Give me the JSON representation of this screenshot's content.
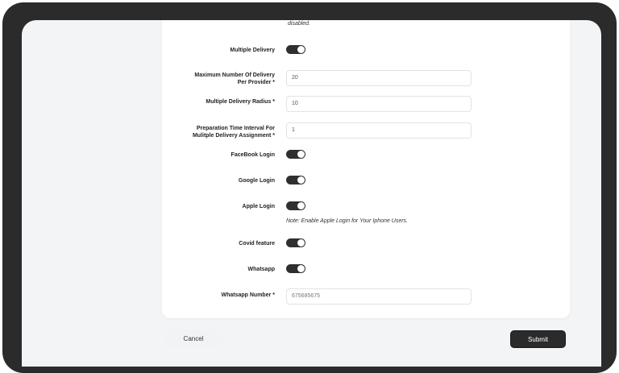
{
  "top_note": "disabled.",
  "fields": {
    "multiple_delivery": {
      "label": "Multiple Delivery"
    },
    "max_delivery": {
      "label_line1": "Maximum Number Of Delivery",
      "label_line2": "Per Provider *",
      "value": "20"
    },
    "delivery_radius": {
      "label": "Multiple Delivery Radius *",
      "value": "10"
    },
    "prep_interval": {
      "label_line1": "Preparation Time Interval For",
      "label_line2": "Mulitple Delivery Assignment *",
      "value": "1"
    },
    "facebook_login": {
      "label": "FaceBook Login"
    },
    "google_login": {
      "label": "Google Login"
    },
    "apple_login": {
      "label": "Apple Login",
      "note": "Note: Enable Apple Login for Your Iphone Users."
    },
    "covid_feature": {
      "label": "Covid feature"
    },
    "whatsapp": {
      "label": "Whatsapp"
    },
    "whatsapp_number": {
      "label": "Whatsapp Number *",
      "placeholder": "675685675"
    }
  },
  "buttons": {
    "cancel": "Cancel",
    "submit": "Submit"
  },
  "colors": {
    "toggle_on": "#2f2f2f",
    "submit_bg": "#2b2b2b",
    "device_frame": "#2b2b2b",
    "cancel_bg": "#f0f4f5"
  }
}
